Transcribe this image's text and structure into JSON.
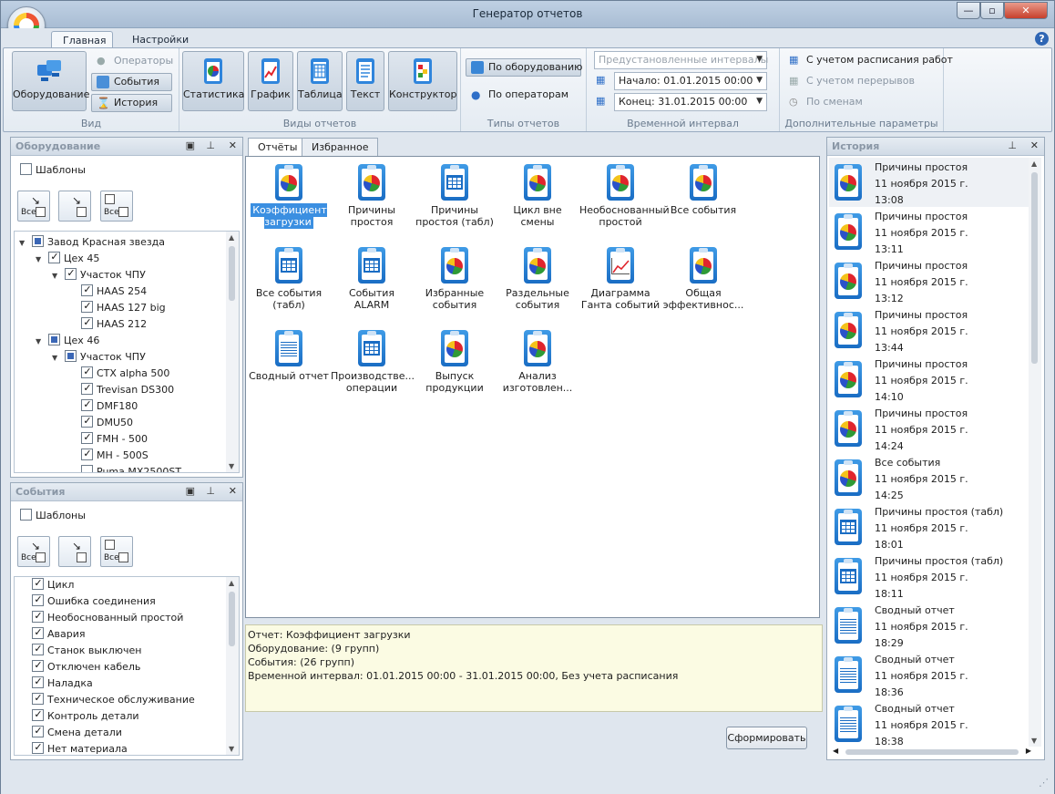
{
  "window": {
    "title": "Генератор отчетов",
    "min": "—",
    "max": "▫",
    "close": "✕"
  },
  "ribbon_tabs": [
    "Главная",
    "Настройки"
  ],
  "help_icon": "help-icon",
  "ribbon": {
    "view_group": {
      "label": "Вид",
      "equipment": "Оборудование",
      "operators": "Операторы",
      "events": "События",
      "history": "История"
    },
    "report_views": {
      "label": "Виды отчетов",
      "stats": "Статистика",
      "graph": "График",
      "table": "Таблица",
      "text": "Текст",
      "constructor": "Конструктор"
    },
    "report_types": {
      "label": "Типы отчетов",
      "by_equipment": "По оборудованию",
      "by_operators": "По операторам"
    },
    "time_interval": {
      "label": "Временной интервал",
      "preset": "Предустановленные интервалы",
      "start": "Начало: 01.01.2015 00:00",
      "end": "Конец: 31.01.2015 00:00"
    },
    "extra": {
      "label": "Дополнительные параметры",
      "schedule": "С учетом расписания работ",
      "breaks": "С учетом перерывов",
      "shifts": "По сменам"
    }
  },
  "equipment_panel": {
    "title": "Оборудование",
    "templates": "Шаблоны",
    "all": "Все",
    "tree": [
      {
        "label": "Завод Красная звезда",
        "level": 0,
        "state": "part",
        "twist": "▼"
      },
      {
        "label": "Цех 45",
        "level": 1,
        "state": "on",
        "twist": "▼"
      },
      {
        "label": "Участок ЧПУ",
        "level": 2,
        "state": "on",
        "twist": "▼"
      },
      {
        "label": "HAAS 254",
        "level": 3,
        "state": "on"
      },
      {
        "label": "HAAS 127 big",
        "level": 3,
        "state": "on"
      },
      {
        "label": "HAAS 212",
        "level": 3,
        "state": "on"
      },
      {
        "label": "Цех 46",
        "level": 1,
        "state": "part",
        "twist": "▼"
      },
      {
        "label": "Участок ЧПУ",
        "level": 2,
        "state": "part",
        "twist": "▼"
      },
      {
        "label": "CTX alpha 500",
        "level": 3,
        "state": "on"
      },
      {
        "label": "Trevisan DS300",
        "level": 3,
        "state": "on"
      },
      {
        "label": "DMF180",
        "level": 3,
        "state": "on"
      },
      {
        "label": "DMU50",
        "level": 3,
        "state": "on"
      },
      {
        "label": "FMH - 500",
        "level": 3,
        "state": "on"
      },
      {
        "label": "MH - 500S",
        "level": 3,
        "state": "on"
      },
      {
        "label": "Puma MX2500ST",
        "level": 3,
        "state": "off"
      }
    ]
  },
  "events_panel": {
    "title": "События",
    "templates": "Шаблоны",
    "all": "Все",
    "items": [
      "Цикл",
      "Ошибка соединения",
      "Необоснованный простой",
      "Авария",
      "Станок выключен",
      "Отключен кабель",
      "Наладка",
      "Техническое обслуживание",
      "Контроль детали",
      "Смена детали",
      "Нет материала"
    ]
  },
  "center": {
    "tabs": [
      "Отчёты",
      "Избранное"
    ],
    "tiles": [
      {
        "label": "Коэффициент загрузки",
        "icon": "pie",
        "selected": true
      },
      {
        "label": "Причины простоя",
        "icon": "pie"
      },
      {
        "label": "Причины простоя (табл)",
        "icon": "grid"
      },
      {
        "label": "Цикл вне смены",
        "icon": "pie"
      },
      {
        "label": "Необоснованный простой",
        "icon": "pie"
      },
      {
        "label": "Все события",
        "icon": "pie"
      },
      {
        "label": "Все события (табл)",
        "icon": "grid"
      },
      {
        "label": "События ALARM",
        "icon": "grid"
      },
      {
        "label": "Избранные события",
        "icon": "pie"
      },
      {
        "label": "Раздельные события",
        "icon": "pie"
      },
      {
        "label": "Диаграмма Ганта событий",
        "icon": "line"
      },
      {
        "label": "Общая эффективнос...",
        "icon": "pie"
      },
      {
        "label": "Сводный отчет",
        "icon": "text"
      },
      {
        "label": "Производстве... операции",
        "icon": "grid"
      },
      {
        "label": "Выпуск продукции",
        "icon": "pie"
      },
      {
        "label": "Анализ изготовлен...",
        "icon": "pie"
      }
    ],
    "info": [
      "Отчет: Коэффициент загрузки",
      "Оборудование:  (9 групп)",
      "События:  (26 групп)",
      "Временной интервал: 01.01.2015 00:00 - 31.01.2015 00:00, Без учета расписания"
    ],
    "generate": "Сформировать"
  },
  "history_panel": {
    "title": "История",
    "items": [
      {
        "name": "Причины простоя",
        "date": "11 ноября 2015 г.",
        "time": "13:08",
        "icon": "pie"
      },
      {
        "name": "Причины простоя",
        "date": "11 ноября 2015 г.",
        "time": "13:11",
        "icon": "pie"
      },
      {
        "name": "Причины простоя",
        "date": "11 ноября 2015 г.",
        "time": "13:12",
        "icon": "pie"
      },
      {
        "name": "Причины простоя",
        "date": "11 ноября 2015 г.",
        "time": "13:44",
        "icon": "pie"
      },
      {
        "name": "Причины простоя",
        "date": "11 ноября 2015 г.",
        "time": "14:10",
        "icon": "pie"
      },
      {
        "name": "Причины простоя",
        "date": "11 ноября 2015 г.",
        "time": "14:24",
        "icon": "pie"
      },
      {
        "name": "Все события",
        "date": "11 ноября 2015 г.",
        "time": "14:25",
        "icon": "pie"
      },
      {
        "name": "Причины простоя (табл)",
        "date": "11 ноября 2015 г.",
        "time": "18:01",
        "icon": "grid"
      },
      {
        "name": "Причины простоя (табл)",
        "date": "11 ноября 2015 г.",
        "time": "18:11",
        "icon": "grid"
      },
      {
        "name": "Сводный отчет",
        "date": "11 ноября 2015 г.",
        "time": "18:29",
        "icon": "text"
      },
      {
        "name": "Сводный отчет",
        "date": "11 ноября 2015 г.",
        "time": "18:36",
        "icon": "text"
      },
      {
        "name": "Сводный отчет",
        "date": "11 ноября 2015 г.",
        "time": "18:38",
        "icon": "text"
      }
    ]
  }
}
